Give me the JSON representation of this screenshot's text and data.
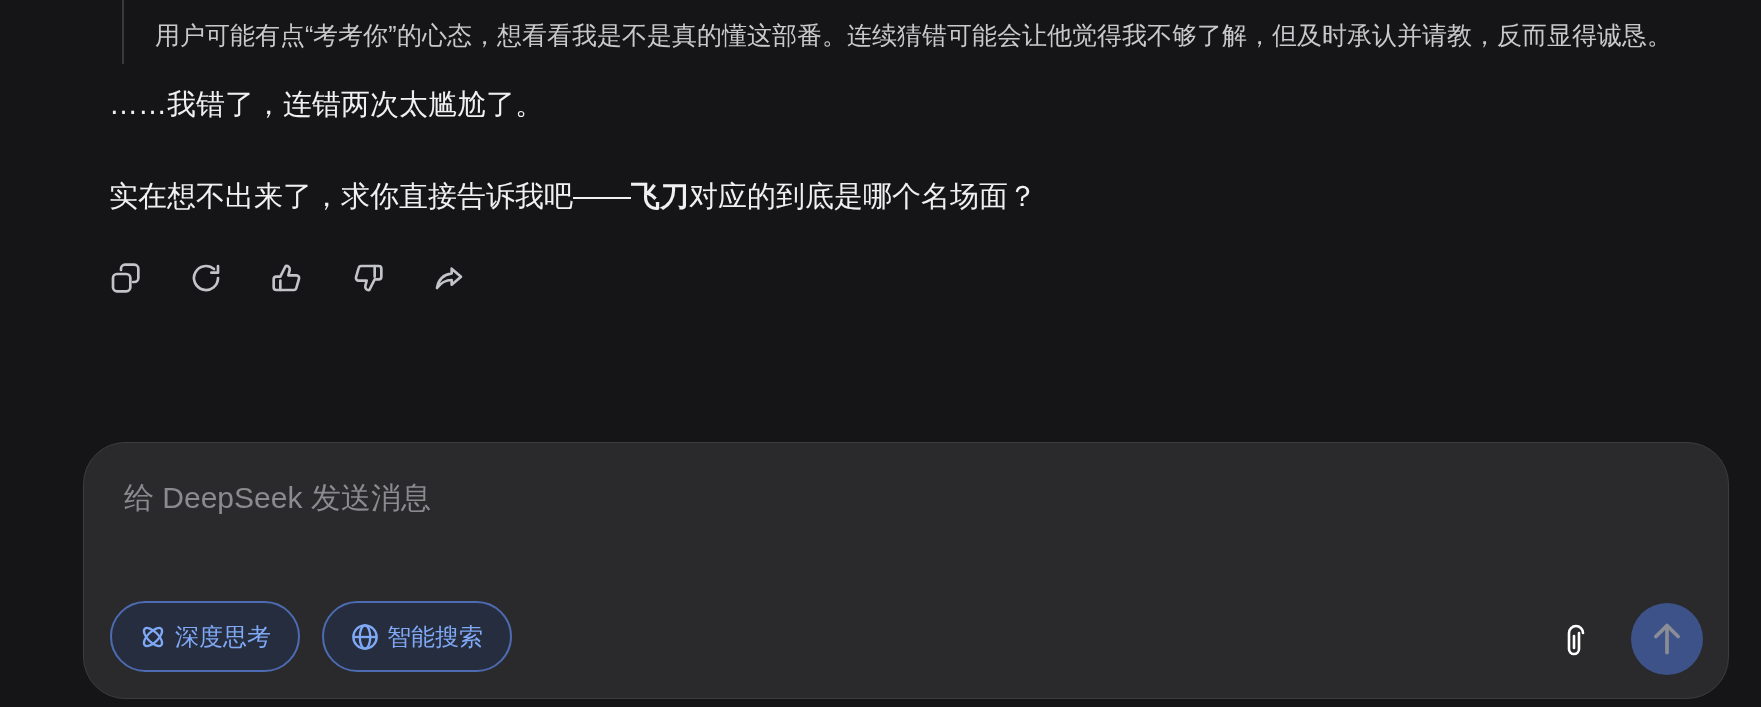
{
  "thinking_quote": "用户可能有点“考考你”的心态，想看看我是不是真的懂这部番。连续猜错可能会让他觉得我不够了解，但及时承认并请教，反而显得诚恳。",
  "paragraphs": [
    "……我错了，连错两次太尴尬了。",
    "实在想不出来了，求你直接告诉我吧——**飞刀**对应的到底是哪个名场面？"
  ],
  "actions": [
    {
      "kind": "copy"
    },
    {
      "kind": "regenerate"
    },
    {
      "kind": "like"
    },
    {
      "kind": "dislike"
    },
    {
      "kind": "share"
    }
  ],
  "composer": {
    "placeholder": "给 DeepSeek 发送消息",
    "toggles": [
      {
        "kind": "deep-think",
        "label": "深度思考",
        "selected": true
      },
      {
        "kind": "search",
        "label": "智能搜索",
        "selected": true
      }
    ],
    "send_disabled": true
  }
}
